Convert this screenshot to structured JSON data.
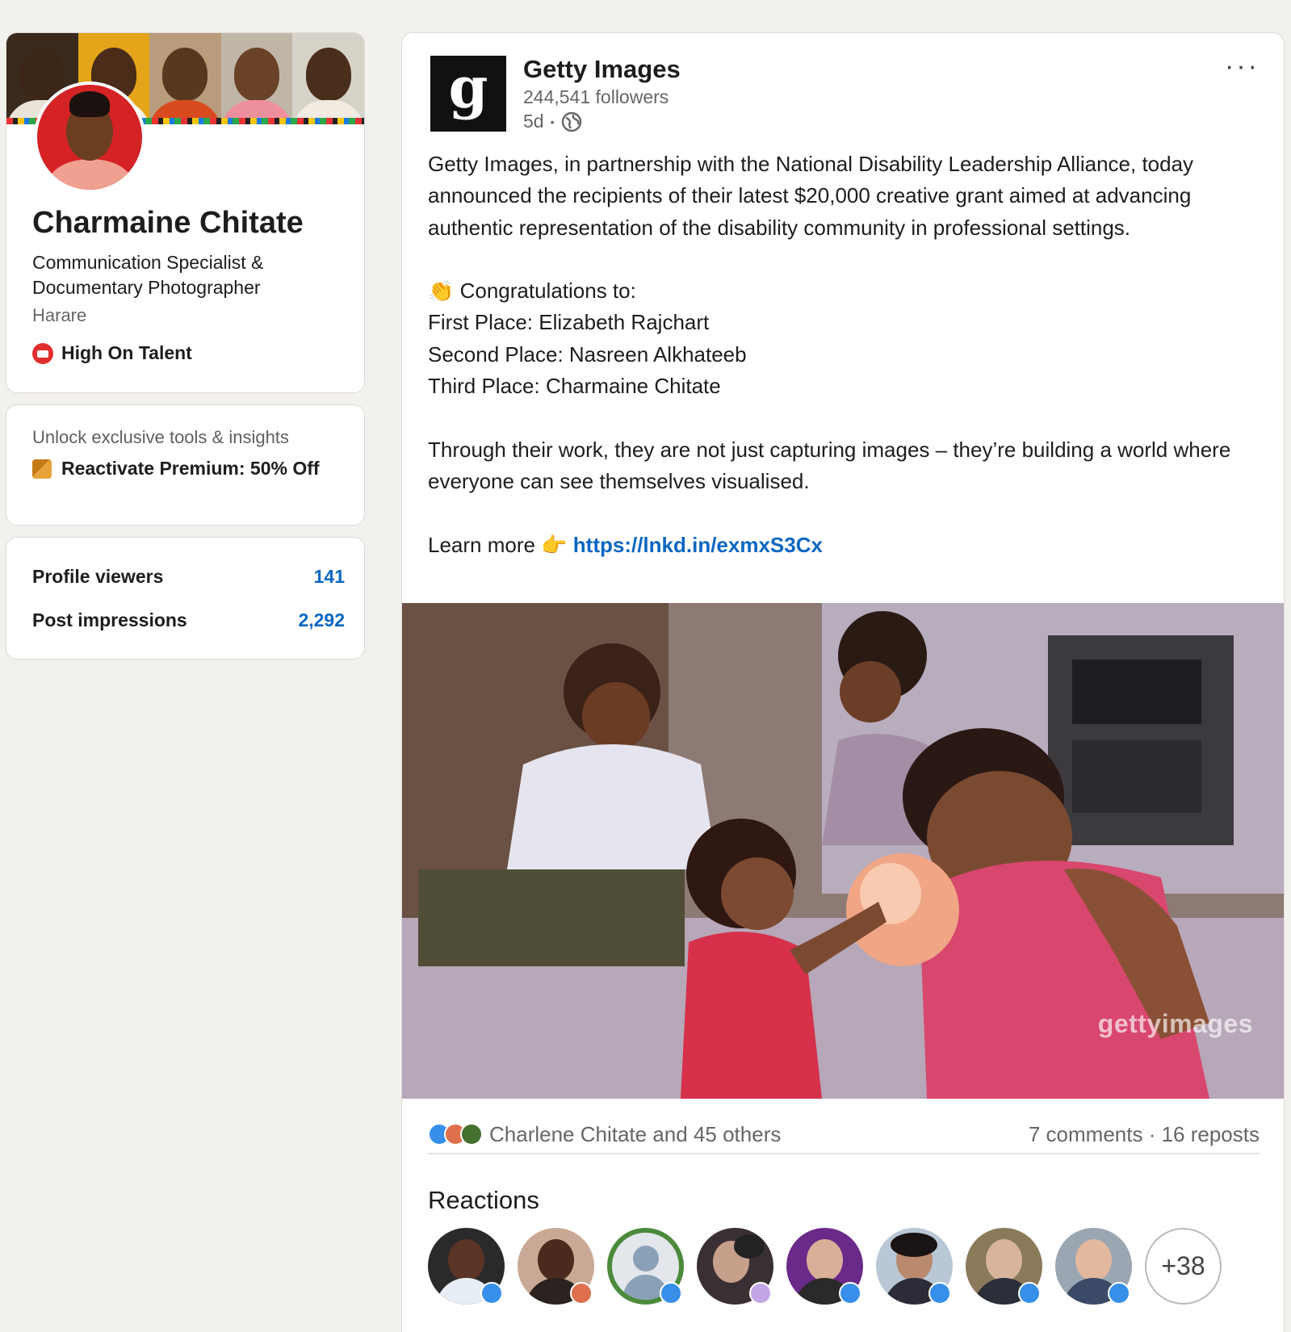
{
  "profile": {
    "name": "Charmaine Chitate",
    "headline": "Communication Specialist & Documentary Photographer",
    "location": "Harare",
    "company": "High On Talent"
  },
  "premium": {
    "subtitle": "Unlock exclusive tools & insights",
    "label": "Reactivate Premium: 50% Off"
  },
  "stats": [
    {
      "label": "Profile viewers",
      "value": "141"
    },
    {
      "label": "Post impressions",
      "value": "2,292"
    }
  ],
  "post": {
    "author": "Getty Images",
    "author_logo_letter": "g",
    "followers": "244,541 followers",
    "age": "5d",
    "separator": "•",
    "more": "···",
    "body": {
      "p1": "Getty Images, in partnership with the National Disability Leadership Alliance, today announced the recipients of their latest $20,000 creative grant aimed at advancing authentic representation of the disability community in professional settings.",
      "congrats": "👏 Congratulations to:",
      "first": "First Place: Elizabeth Rajchart",
      "second": "Second Place: Nasreen Alkhateeb",
      "third": "Third Place: Charmaine Chitate",
      "p3": "Through their work, they are not just capturing images – they’re building a world where everyone can see themselves visualised.",
      "learn_more": "Learn more 👉 ",
      "link": "https://lnkd.in/exmxS3Cx"
    },
    "image_watermark": "gettyimages",
    "reactors_summary": "Charlene Chitate and 45 others",
    "comments_reposts": "7 comments · 16 reposts",
    "reactions_heading": "Reactions",
    "more_reactors": "+38"
  },
  "colors": {
    "background": "#f3f1ed",
    "link": "#0a66c2",
    "like": "#378fe9",
    "love": "#df704d"
  }
}
